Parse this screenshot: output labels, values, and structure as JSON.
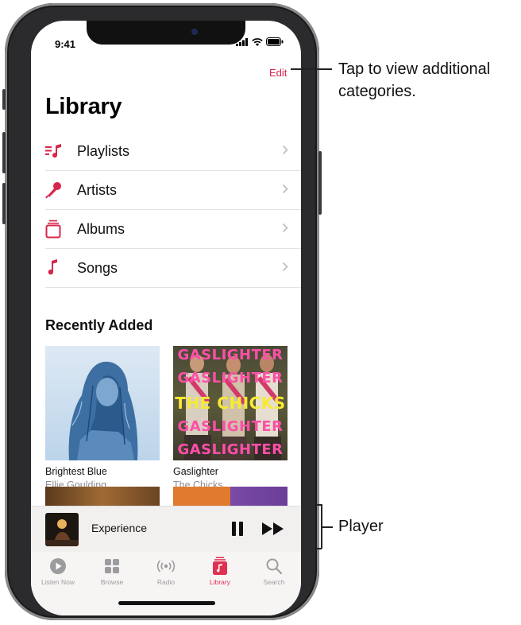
{
  "status_bar": {
    "time": "9:41"
  },
  "header": {
    "edit_label": "Edit",
    "title": "Library"
  },
  "categories": [
    {
      "label": "Playlists",
      "icon": "playlist-icon"
    },
    {
      "label": "Artists",
      "icon": "microphone-icon"
    },
    {
      "label": "Albums",
      "icon": "album-stack-icon"
    },
    {
      "label": "Songs",
      "icon": "music-note-icon"
    }
  ],
  "recently_added": {
    "title": "Recently Added",
    "albums": [
      {
        "title": "Brightest Blue",
        "artist": "Ellie Goulding"
      },
      {
        "title": "Gaslighter",
        "artist": "The Chicks",
        "cover_lines": [
          "GASLIGHTER",
          "GASLIGHTER",
          "THE CHICKS",
          "GASLIGHTER",
          "GASLIGHTER"
        ]
      }
    ]
  },
  "player": {
    "title": "Experience"
  },
  "tabs": [
    {
      "label": "Listen Now",
      "icon": "play-circle-icon",
      "active": false
    },
    {
      "label": "Browse",
      "icon": "grid-icon",
      "active": false
    },
    {
      "label": "Radio",
      "icon": "radio-waves-icon",
      "active": false
    },
    {
      "label": "Library",
      "icon": "library-icon",
      "active": true
    },
    {
      "label": "Search",
      "icon": "search-icon",
      "active": false
    }
  ],
  "callouts": {
    "edit": "Tap to view additional categories.",
    "player": "Player"
  },
  "colors": {
    "accent": "#d8264b",
    "separator": "#e3e3e6",
    "secondary_text": "#8e8e93"
  }
}
